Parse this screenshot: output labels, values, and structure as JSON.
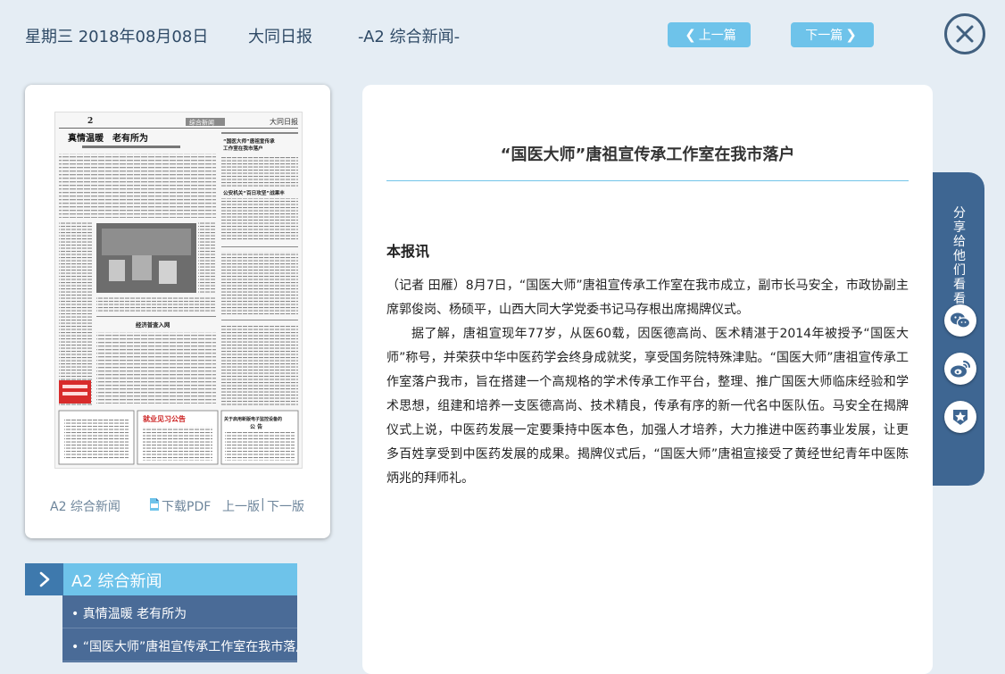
{
  "header": {
    "date": "星期三 2018年08月08日",
    "paper_name": "大同日报",
    "page_label": "-A2 综合新闻-",
    "prev_label": "上一篇",
    "next_label": "下一篇"
  },
  "thumbnail": {
    "page_no": "2",
    "tab": "综合新闻",
    "masthead": "大同日报",
    "headline1": "真情温暖　老有所为",
    "headline2": "“国医大师”唐祖宣传承工作室在我市落户",
    "headline3": "公安机关“百日攻坚”战果丰",
    "headline4": "经济普查入网",
    "headline5": "就业见习公告",
    "headline6": "关于启用新版电子监控设备的公告"
  },
  "paper_card": {
    "page_label": "A2 综合新闻",
    "download_label": "下载PDF",
    "prev_page": "上一版",
    "next_page": "下一版"
  },
  "section": {
    "title": "A2  综合新闻",
    "items": [
      "• 真情温暖 老有所为",
      "• “国医大师”唐祖宣传承工作室在我市落户"
    ]
  },
  "article": {
    "title": "“国医大师”唐祖宣传承工作室在我市落户",
    "lead": "本报讯",
    "paragraphs": [
      "（记者 田雁）8月7日，“国医大师”唐祖宣传承工作室在我市成立，副市长马安全，市政协副主席郭俊岗、杨硕平，山西大同大学党委书记马存根出席揭牌仪式。",
      "据了解，唐祖宣现年77岁，从医60载，因医德高尚、医术精湛于2014年被授予“国医大师”称号，并荣获中华中医药学会终身成就奖，享受国务院特殊津贴。“国医大师”唐祖宣传承工作室落户我市，旨在搭建一个高规格的学术传承工作平台，整理、推广国医大师临床经验和学术思想，组建和培养一支医德高尚、技术精良，传承有序的新一代名中医队伍。马安全在揭牌仪式上说，中医药发展一定要秉持中医本色，加强人才培养，大力推进中医药事业发展，让更多百姓享受到中医药发展的成果。揭牌仪式后，“国医大师”唐祖宣接受了黄经世纪青年中医陈炳兆的拜师礼。"
    ]
  },
  "share": {
    "label": "分享给他们看看"
  },
  "colors": {
    "background": "#e5edf4",
    "accent_light": "#6ec3ea",
    "accent_dark": "#3e79ad",
    "panel_dark": "#3e6692",
    "text_dark": "#2f4a66"
  }
}
